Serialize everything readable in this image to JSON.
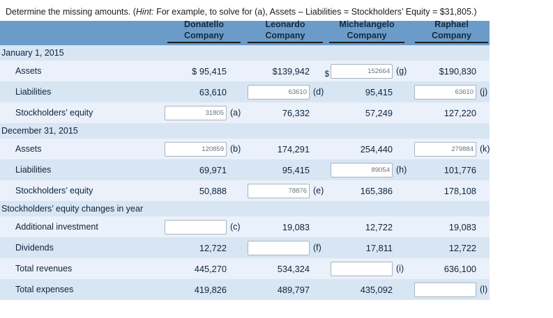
{
  "page": {
    "instruction_prefix": "Determine the missing amounts. (",
    "instruction_hint_label": "Hint:",
    "instruction_suffix": " For example, to solve for (a), Assets – Liabilities = Stockholders’ Equity = $31,805.)"
  },
  "colors": {
    "header_bg": "#6b9cc9",
    "row_dark": "#d8e5f3",
    "row_light": "#eaf1fa",
    "text": "#10233c",
    "input_border": "#aab4bc",
    "input_text": "#667181"
  },
  "table": {
    "columns": [
      {
        "line1": "Donatello",
        "line2": "Company"
      },
      {
        "line1": "Leonardo",
        "line2": "Company"
      },
      {
        "line1": "Michelangelo",
        "line2": "Company"
      },
      {
        "line1": "Raphael",
        "line2": "Company"
      }
    ],
    "rows": [
      {
        "type": "section",
        "label": "January 1, 2015"
      },
      {
        "type": "data",
        "label": "Assets",
        "cells": [
          {
            "t": "$ 95,415"
          },
          {
            "t": "$139,942"
          },
          {
            "input": "152664",
            "tag": "(g)",
            "prefix": "$"
          },
          {
            "t": "$190,830"
          }
        ]
      },
      {
        "type": "data",
        "label": "Liabilities",
        "cells": [
          {
            "t": "63,610"
          },
          {
            "input": "63610",
            "tag": "(d)"
          },
          {
            "t": "95,415"
          },
          {
            "input": "63610",
            "tag": "(j)"
          }
        ]
      },
      {
        "type": "data",
        "label": "Stockholders’ equity",
        "cells": [
          {
            "input": "31805",
            "tag": "(a)"
          },
          {
            "t": "76,332"
          },
          {
            "t": "57,249"
          },
          {
            "t": "127,220"
          }
        ]
      },
      {
        "type": "section",
        "label": "December 31, 2015"
      },
      {
        "type": "data",
        "label": "Assets",
        "cells": [
          {
            "input": "120859",
            "tag": "(b)"
          },
          {
            "t": "174,291"
          },
          {
            "t": "254,440"
          },
          {
            "input": "279884",
            "tag": "(k)"
          }
        ]
      },
      {
        "type": "data",
        "label": "Liabilities",
        "cells": [
          {
            "t": "69,971"
          },
          {
            "t": "95,415"
          },
          {
            "input": "89054",
            "tag": "(h)"
          },
          {
            "t": "101,776"
          }
        ]
      },
      {
        "type": "data",
        "label": "Stockholders’ equity",
        "cells": [
          {
            "t": "50,888"
          },
          {
            "input": "78876",
            "tag": "(e)"
          },
          {
            "t": "165,386"
          },
          {
            "t": "178,108"
          }
        ]
      },
      {
        "type": "section",
        "label": "Stockholders’ equity changes in year"
      },
      {
        "type": "data",
        "label": "Additional investment",
        "cells": [
          {
            "input": "",
            "tag": "(c)"
          },
          {
            "t": "19,083"
          },
          {
            "t": "12,722"
          },
          {
            "t": "19,083"
          }
        ]
      },
      {
        "type": "data",
        "label": "Dividends",
        "cells": [
          {
            "t": "12,722"
          },
          {
            "input": "",
            "tag": "(f)"
          },
          {
            "t": "17,811"
          },
          {
            "t": "12,722"
          }
        ]
      },
      {
        "type": "data",
        "label": "Total revenues",
        "cells": [
          {
            "t": "445,270"
          },
          {
            "t": "534,324"
          },
          {
            "input": "",
            "tag": "(i)"
          },
          {
            "t": "636,100"
          }
        ]
      },
      {
        "type": "data",
        "label": "Total expenses",
        "cells": [
          {
            "t": "419,826"
          },
          {
            "t": "489,797"
          },
          {
            "t": "435,092"
          },
          {
            "input": "",
            "tag": "(l)"
          }
        ]
      }
    ]
  }
}
